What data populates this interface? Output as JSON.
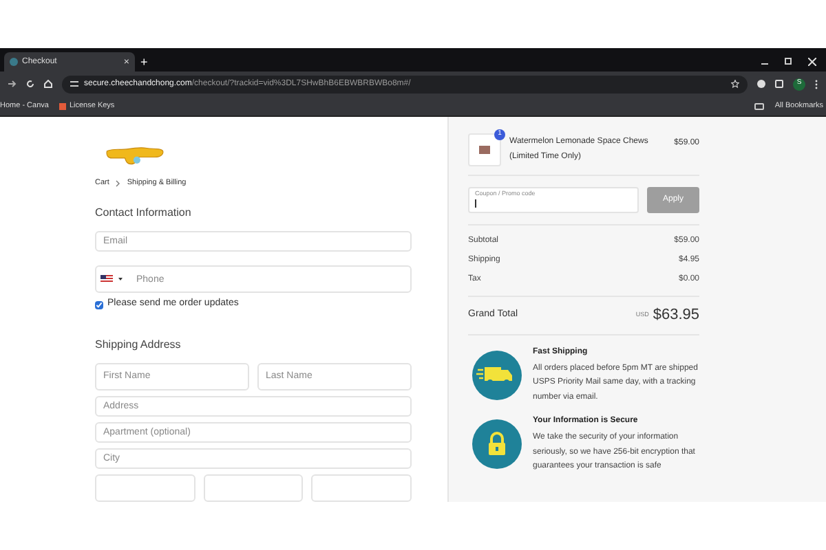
{
  "browser": {
    "tab": {
      "title": "Checkout",
      "close": "×"
    },
    "new_tab": "+",
    "url_host": "secure.cheechandchong.com",
    "url_path": "/checkout/?trackid=vid%3DL7SHwBhB6EBWBRBWBo8m#/",
    "profile": "S",
    "bookmarks": [
      {
        "label": "Home - Canva"
      },
      {
        "label": "License Keys"
      }
    ],
    "all_bookmarks": "All Bookmarks"
  },
  "breadcrumb": [
    {
      "label": "Cart"
    },
    {
      "label": "Shipping & Billing"
    }
  ],
  "contact": {
    "heading": "Contact Information",
    "email": {
      "placeholder": "Email"
    },
    "phone": {
      "placeholder": "Phone"
    },
    "updates": {
      "label": "Please send me order updates",
      "checked": true
    }
  },
  "shipping": {
    "heading": "Shipping Address",
    "first_name": {
      "placeholder": "First Name"
    },
    "last_name": {
      "placeholder": "Last Name"
    },
    "address": {
      "placeholder": "Address"
    },
    "apartment": {
      "placeholder": "Apartment (optional)"
    },
    "city": {
      "placeholder": "City"
    }
  },
  "order": {
    "item": {
      "name": "Watermelon Lemonade Space Chews (Limited Time Only)",
      "price": "$59.00",
      "quantity": "1"
    },
    "coupon": {
      "placeholder": "Coupon / Promo code",
      "button": "Apply"
    },
    "lines": [
      {
        "label": "Subtotal",
        "value": "$59.00"
      },
      {
        "label": "Shipping",
        "value": "$4.95"
      },
      {
        "label": "Tax",
        "value": "$0.00"
      }
    ],
    "total": {
      "label": "Grand Total",
      "currency": "USD",
      "value": "$63.95"
    }
  },
  "features": [
    {
      "kind": "truck",
      "title": "Fast Shipping",
      "text": "All orders placed before 5pm MT are shipped USPS Priority Mail same day, with a tracking number via email."
    },
    {
      "kind": "lock",
      "title": "Your Information is Secure",
      "text": "We take the security of your information seriously, so we have 256-bit encryption that guarantees your transaction is safe"
    }
  ]
}
